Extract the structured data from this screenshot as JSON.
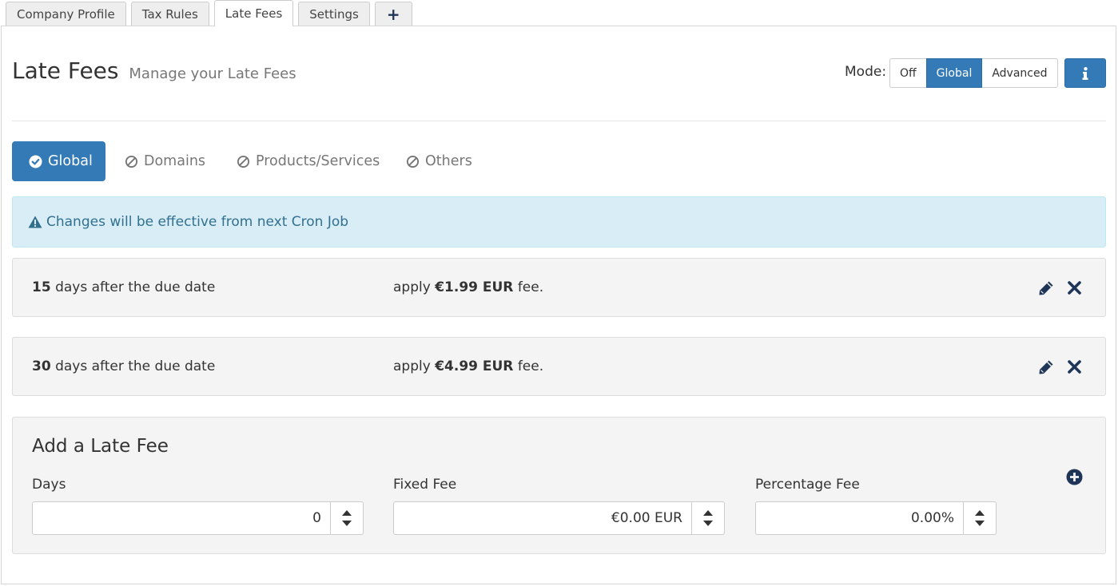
{
  "top_tabs": [
    {
      "label": "Company Profile"
    },
    {
      "label": "Tax Rules"
    },
    {
      "label": "Late Fees"
    },
    {
      "label": "Settings"
    },
    {
      "label": "+"
    }
  ],
  "header": {
    "title": "Late Fees",
    "subtitle": "Manage your Late Fees",
    "mode_label": "Mode:",
    "mode_options": [
      "Off",
      "Global",
      "Advanced"
    ],
    "mode_selected": "Global",
    "info_icon": "info-icon"
  },
  "subnav": {
    "items": [
      {
        "label": "Global",
        "icon": "check-circle-icon",
        "active": true
      },
      {
        "label": "Domains",
        "icon": "ban-icon",
        "active": false
      },
      {
        "label": "Products/Services",
        "icon": "ban-icon",
        "active": false
      },
      {
        "label": "Others",
        "icon": "ban-icon",
        "active": false
      }
    ]
  },
  "alert": {
    "icon": "warning-icon",
    "text": "Changes will be effective from next Cron Job"
  },
  "fees": [
    {
      "days": "15",
      "days_text": "days after the due date",
      "apply_prefix": "apply",
      "amount": "€1.99 EUR",
      "apply_suffix": "fee."
    },
    {
      "days": "30",
      "days_text": "days after the due date",
      "apply_prefix": "apply",
      "amount": "€4.99 EUR",
      "apply_suffix": "fee."
    }
  ],
  "add_panel": {
    "title": "Add a Late Fee",
    "days_label": "Days",
    "days_value": "0",
    "fixed_label": "Fixed Fee",
    "fixed_value": "€0.00 EUR",
    "percent_label": "Percentage Fee",
    "percent_value": "0.00%"
  },
  "colors": {
    "primary": "#337ab7",
    "dark_icon": "#1f3558",
    "alert_bg": "#d9edf7",
    "alert_text": "#31708f",
    "panel_bg": "#f4f4f4"
  }
}
